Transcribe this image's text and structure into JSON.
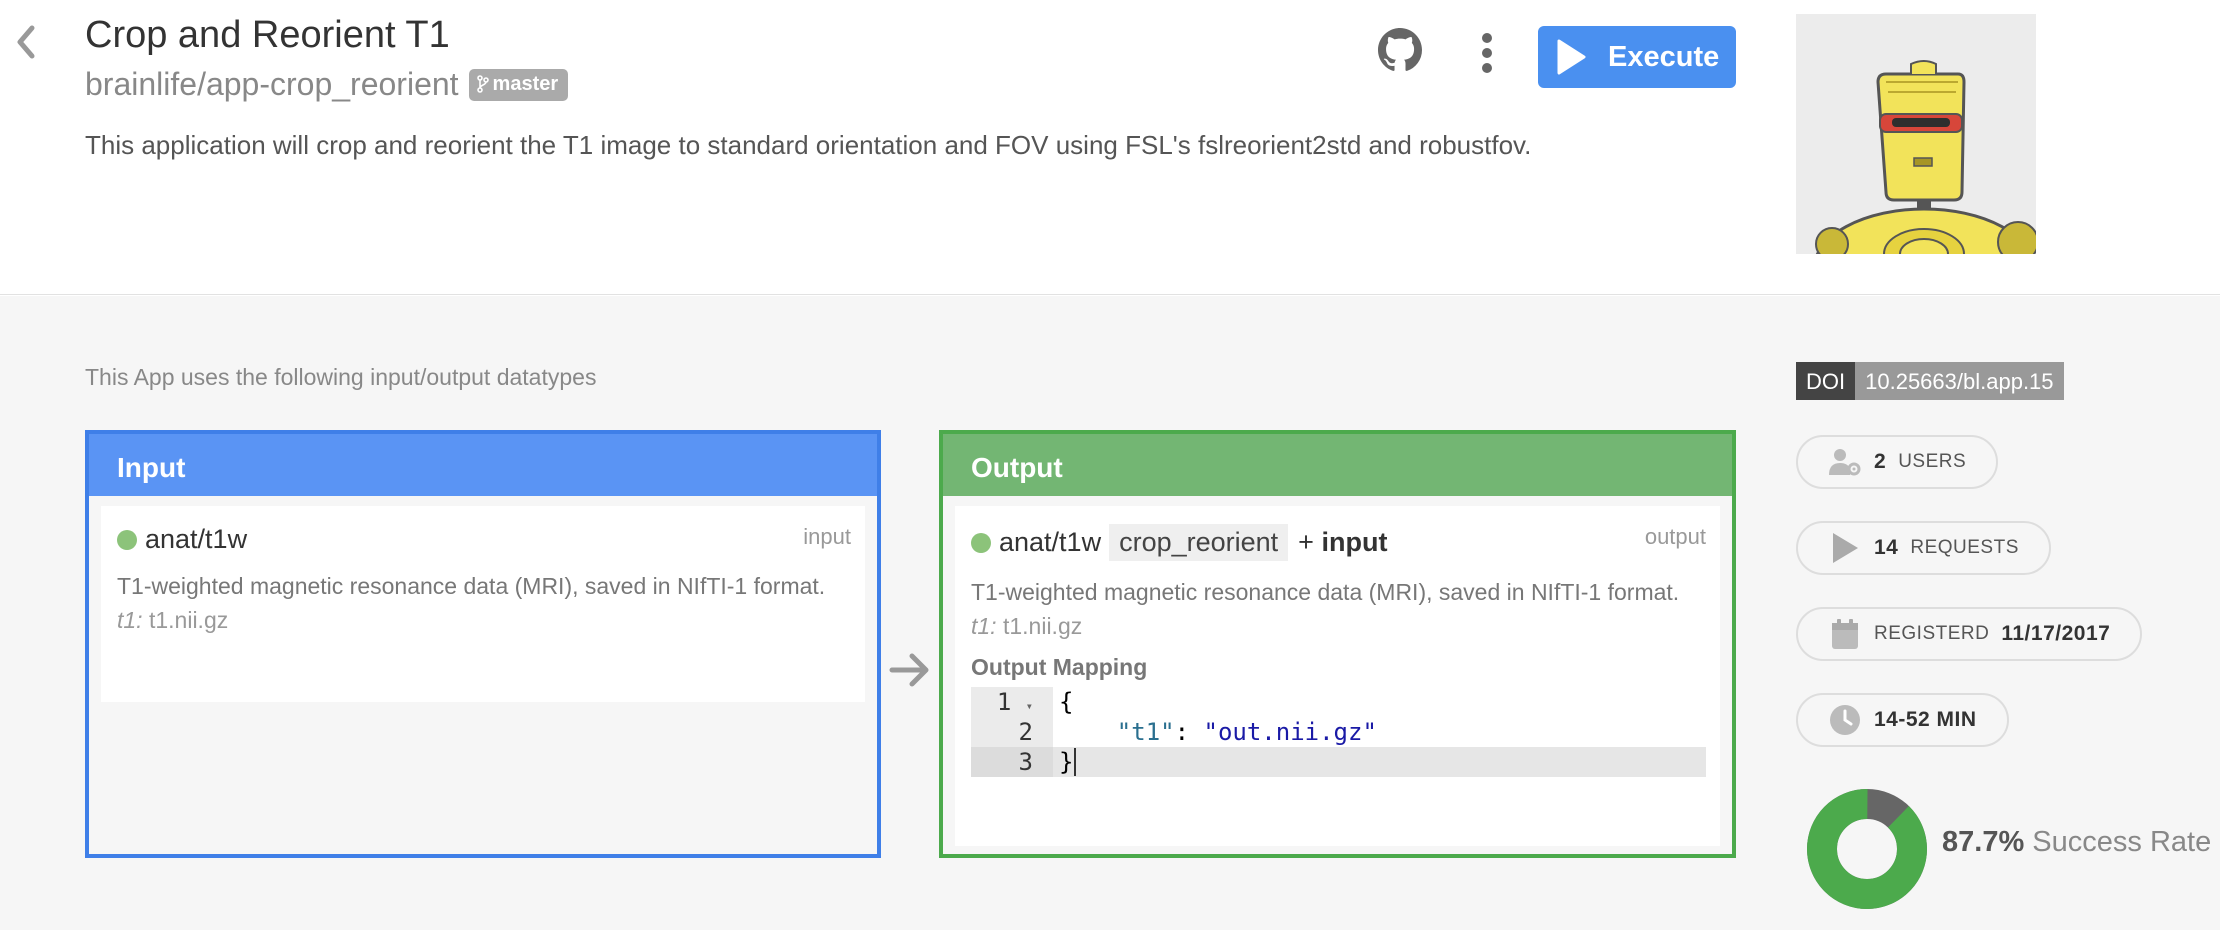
{
  "app": {
    "title": "Crop and Reorient T1",
    "repo": "brainlife/app-crop_reorient",
    "branch": "master",
    "description": "This application will crop and reorient the T1 image to standard orientation and FOV using FSL's fslreorient2std and robustfov.",
    "execute_label": "Execute"
  },
  "icons": {
    "back": "chevron-left-icon",
    "github": "github-icon",
    "menu": "more-vertical-icon",
    "execute": "play-icon",
    "branch": "code-branch-icon",
    "users": "user-gear-icon",
    "requests": "play-icon",
    "registered": "calendar-icon",
    "duration": "clock-icon",
    "flow": "arrow-right-icon"
  },
  "datatypes": {
    "intro": "This App uses the following input/output datatypes",
    "input": {
      "header": "Input",
      "datatype": "anat/t1w",
      "role": "input",
      "description": "T1-weighted magnetic resonance data (MRI), saved in NIfTI-1 format.",
      "file_key": "t1:",
      "file_name": "t1.nii.gz"
    },
    "output": {
      "header": "Output",
      "datatype": "anat/t1w",
      "tag": "crop_reorient",
      "plus": "+",
      "plus_input": "input",
      "role": "output",
      "description": "T1-weighted magnetic resonance data (MRI), saved in NIfTI-1 format.",
      "file_key": "t1:",
      "file_name": "t1.nii.gz",
      "mapping_title": "Output Mapping",
      "code": {
        "line1_no": "1",
        "line2_no": "2",
        "line3_no": "3",
        "open": "{",
        "key": "\"t1\"",
        "colon": ": ",
        "value": "\"out.nii.gz\"",
        "close": "}"
      }
    }
  },
  "stats": {
    "doi_label": "DOI",
    "doi_value": "10.25663/bl.app.15",
    "users_count": "2",
    "users_label": "USERS",
    "requests_count": "14",
    "requests_label": "REQUESTS",
    "registered_label": "REGISTERD",
    "registered_date": "11/17/2017",
    "duration": "14-52 MIN",
    "success_rate_value": "87.7%",
    "success_rate_label": "Success Rate",
    "success_fraction": 0.877,
    "colors": {
      "success": "#4caa4c",
      "failure": "#666666"
    }
  },
  "colors": {
    "accent": "#4a90f0",
    "input_border": "#3f7fe8",
    "output_border": "#4caa4c"
  }
}
